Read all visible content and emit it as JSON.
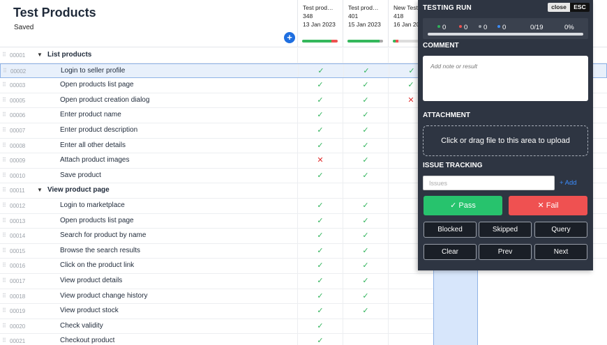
{
  "header": {
    "title": "Test Products",
    "status": "Saved",
    "add_icon": "+"
  },
  "runs": [
    {
      "name": "Test prod…",
      "count": "348",
      "date": "13 Jan 2023"
    },
    {
      "name": "Test prod…",
      "count": "401",
      "date": "15 Jan 2023"
    },
    {
      "name": "New Test",
      "count": "418",
      "date": "16 Jan 20"
    }
  ],
  "rows": [
    {
      "num": "00001",
      "label": "List products",
      "section": true,
      "results": [
        "",
        "",
        ""
      ]
    },
    {
      "num": "00002",
      "label": "Login to seller profile",
      "selected": true,
      "results": [
        "pass",
        "pass",
        "pass"
      ]
    },
    {
      "num": "00003",
      "label": "Open products list page",
      "results": [
        "pass",
        "pass",
        "pass"
      ]
    },
    {
      "num": "00005",
      "label": "Open product creation dialog",
      "results": [
        "pass",
        "pass",
        "fail"
      ]
    },
    {
      "num": "00006",
      "label": "Enter product name",
      "results": [
        "pass",
        "pass",
        ""
      ]
    },
    {
      "num": "00007",
      "label": "Enter product description",
      "results": [
        "pass",
        "pass",
        ""
      ]
    },
    {
      "num": "00008",
      "label": "Enter all other details",
      "results": [
        "pass",
        "pass",
        ""
      ]
    },
    {
      "num": "00009",
      "label": "Attach product images",
      "results": [
        "fail",
        "pass",
        ""
      ]
    },
    {
      "num": "00010",
      "label": "Save product",
      "results": [
        "pass",
        "pass",
        ""
      ]
    },
    {
      "num": "00011",
      "label": "View product page",
      "section": true,
      "results": [
        "",
        "",
        ""
      ]
    },
    {
      "num": "00012",
      "label": "Login to marketplace",
      "results": [
        "pass",
        "pass",
        ""
      ]
    },
    {
      "num": "00013",
      "label": "Open products list page",
      "results": [
        "pass",
        "pass",
        ""
      ]
    },
    {
      "num": "00014",
      "label": "Search for product by name",
      "results": [
        "pass",
        "pass",
        ""
      ]
    },
    {
      "num": "00015",
      "label": "Browse the search results",
      "results": [
        "pass",
        "pass",
        ""
      ]
    },
    {
      "num": "00016",
      "label": "Click on the product link",
      "results": [
        "pass",
        "pass",
        ""
      ]
    },
    {
      "num": "00017",
      "label": "View product details",
      "results": [
        "pass",
        "pass",
        ""
      ]
    },
    {
      "num": "00018",
      "label": "View product change history",
      "results": [
        "pass",
        "pass",
        ""
      ]
    },
    {
      "num": "00019",
      "label": "View product stock",
      "results": [
        "pass",
        "pass",
        ""
      ]
    },
    {
      "num": "00020",
      "label": "Check validity",
      "results": [
        "pass",
        "",
        ""
      ]
    },
    {
      "num": "00021",
      "label": "Checkout product",
      "results": [
        "pass",
        "",
        ""
      ]
    }
  ],
  "symbols": {
    "pass": "✓",
    "fail": "✕"
  },
  "panel": {
    "title": "TESTING RUN",
    "close_label": "close",
    "esc_label": "ESC",
    "stats": [
      {
        "value": "0",
        "color": "#2fb35a"
      },
      {
        "value": "0",
        "color": "#ef5151"
      },
      {
        "value": "0",
        "color": "#9aa0a8"
      },
      {
        "value": "0",
        "color": "#3b8dff"
      }
    ],
    "progress_text": "0/19",
    "progress_percent": "0%",
    "comment_heading": "COMMENT",
    "comment_placeholder": "Add note or result",
    "attachment_heading": "ATTACHMENT",
    "dropzone_text": "Click or drag file to this area to upload",
    "issue_heading": "ISSUE TRACKING",
    "issues_placeholder": "Issues",
    "add_link": "+ Add",
    "pass_label": "✓ Pass",
    "fail_label": "✕ Fail",
    "blocked_label": "Blocked",
    "skipped_label": "Skipped",
    "query_label": "Query",
    "clear_label": "Clear",
    "prev_label": "Prev",
    "next_label": "Next"
  },
  "colors": {
    "accent": "#1f6fe0",
    "pass": "#2fb35a",
    "fail": "#e02c2c",
    "panel_bg": "#2e3542"
  }
}
